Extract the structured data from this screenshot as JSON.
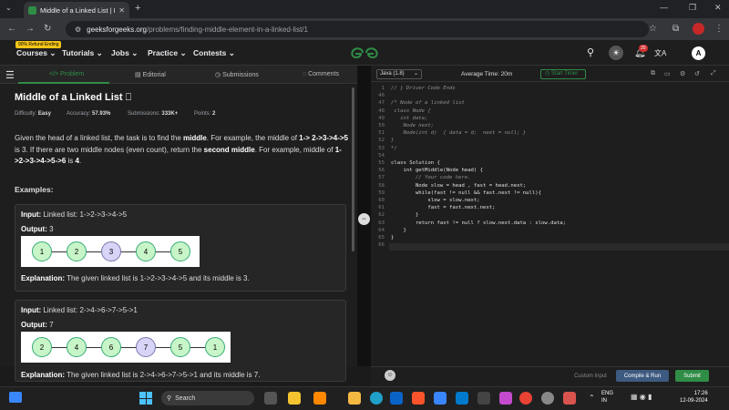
{
  "browser": {
    "tab_title": "Middle of a Linked List | Practic",
    "url_domain": "geeksforgeeks.org",
    "url_path": "/problems/finding-middle-element-in-a-linked-list/1"
  },
  "header": {
    "badge": "90% Refund Ending",
    "menu": [
      "Courses",
      "Tutorials",
      "Jobs",
      "Practice",
      "Contests"
    ],
    "notif_count": "20",
    "avatar_letter": "A"
  },
  "left_tabs": [
    "Problem",
    "Editorial",
    "Submissions",
    "Comments"
  ],
  "problem": {
    "title": "Middle of a Linked List",
    "difficulty_label": "Difficulty:",
    "difficulty": "Easy",
    "accuracy_label": "Accuracy:",
    "accuracy": "57.93%",
    "submissions_label": "Submissions:",
    "submissions": "333K+",
    "points_label": "Points:",
    "points": "2",
    "desc_1": "Given the head of a linked list, the task is to find the ",
    "desc_b1": "middle",
    "desc_2": ". For example, the middle of ",
    "desc_b2": "1-> 2->3->4->5",
    "desc_3": " is 3. If there are two middle nodes (even count), return the ",
    "desc_b3": "second middle",
    "desc_4": ". For example, middle of ",
    "desc_b4": "1->2->3->4->5->6",
    "desc_5": " is ",
    "desc_b5": "4",
    "desc_6": ".",
    "examples_heading": "Examples:"
  },
  "examples": [
    {
      "input_label": "Input:",
      "input": "Linked list: 1->2->3->4->5",
      "output_label": "Output:",
      "output": "3",
      "nodes": [
        "1",
        "2",
        "3",
        "4",
        "5"
      ],
      "middle_index": 2,
      "expl_label": "Explanation:",
      "explanation": "The given linked list is 1->2->3->4->5 and its middle is 3."
    },
    {
      "input_label": "Input:",
      "input": "Linked list: 2->4->6->7->5->1",
      "output_label": "Output:",
      "output": "7",
      "nodes": [
        "2",
        "4",
        "6",
        "7",
        "5",
        "1"
      ],
      "middle_index": 3,
      "expl_label": "Explanation:",
      "explanation": "The given linked list is 2->4->6->7->5->1 and its middle is 7."
    }
  ],
  "editor": {
    "language": "Java (1.8)",
    "avg_time": "Average Time: 20m",
    "timer_label": "Start Timer",
    "custom_input": "Custom Input",
    "compile_run": "Compile & Run",
    "submit": "Submit",
    "lines": [
      {
        "n": "1",
        "t": "// } Driver Code Ends",
        "c": "cm"
      },
      {
        "n": "46",
        "t": "",
        "c": ""
      },
      {
        "n": "47",
        "t": "/* Node of a linked list",
        "c": "cm"
      },
      {
        "n": "48",
        "t": " class Node {",
        "c": "cm"
      },
      {
        "n": "49",
        "t": "   int data;",
        "c": "cm"
      },
      {
        "n": "50",
        "t": "    Node next;",
        "c": "cm"
      },
      {
        "n": "51",
        "t": "    Node(int d)  { data = d;  next = null; }",
        "c": "cm"
      },
      {
        "n": "52",
        "t": "}",
        "c": "cm"
      },
      {
        "n": "53",
        "t": "*/",
        "c": "cm"
      },
      {
        "n": "54",
        "t": "",
        "c": ""
      },
      {
        "n": "55",
        "t": "class Solution {",
        "c": ""
      },
      {
        "n": "56",
        "t": "    int getMiddle(Node head) {",
        "c": ""
      },
      {
        "n": "57",
        "t": "        // Your code here.",
        "c": "cm"
      },
      {
        "n": "58",
        "t": "        Node slow = head , fast = head.next;",
        "c": ""
      },
      {
        "n": "59",
        "t": "        while(fast != null && fast.next != null){",
        "c": ""
      },
      {
        "n": "60",
        "t": "            slow = slow.next;",
        "c": ""
      },
      {
        "n": "61",
        "t": "            fast = fast.next.next;",
        "c": ""
      },
      {
        "n": "62",
        "t": "        }",
        "c": ""
      },
      {
        "n": "63",
        "t": "        return fast != null ? slow.next.data : slow.data;",
        "c": ""
      },
      {
        "n": "64",
        "t": "    }",
        "c": ""
      },
      {
        "n": "65",
        "t": "}",
        "c": ""
      },
      {
        "n": "66",
        "t": "",
        "c": ""
      }
    ]
  },
  "taskbar": {
    "search": "Search",
    "lang": "ENG",
    "region": "IN",
    "time": "17:26",
    "date": "12-09-2024"
  }
}
